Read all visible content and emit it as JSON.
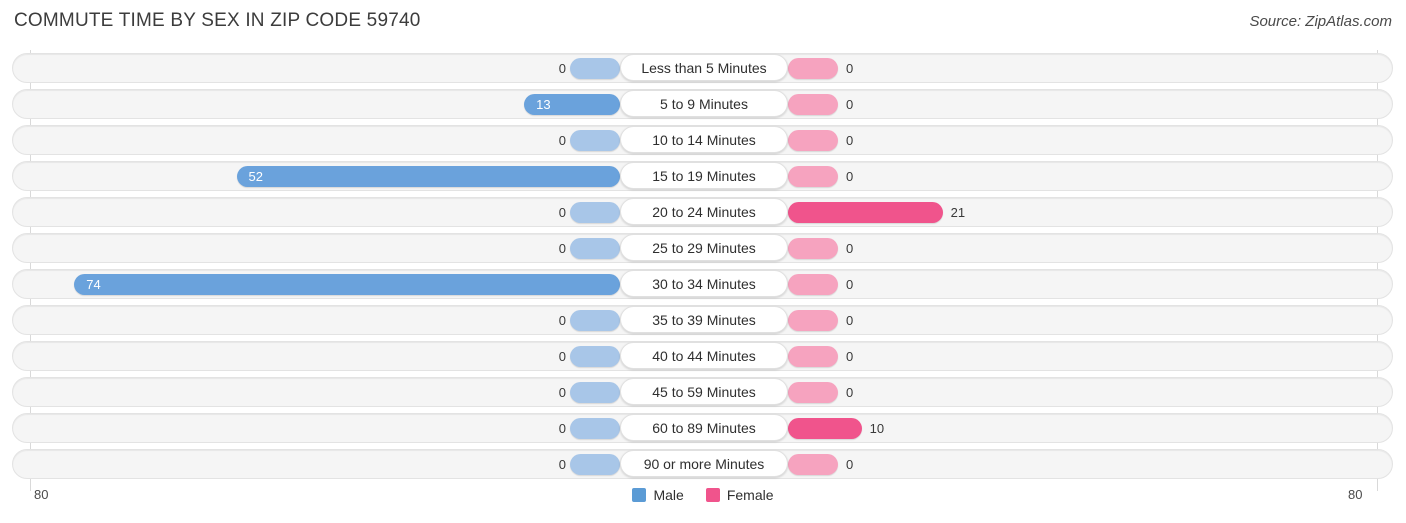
{
  "header": {
    "title": "COMMUTE TIME BY SEX IN ZIP CODE 59740",
    "source": "Source: ZipAtlas.com"
  },
  "axis": {
    "left_label": "80",
    "right_label": "80",
    "max": 80
  },
  "legend": {
    "items": [
      {
        "label": "Male",
        "color": "#5b9bd5",
        "icon": "square-swatch"
      },
      {
        "label": "Female",
        "color": "#f0548c",
        "icon": "square-swatch"
      }
    ]
  },
  "colors": {
    "male_active": "#6aa2dc",
    "male_zero": "#a8c6e8",
    "female_active": "#f0548c",
    "female_zero": "#f6a3bf",
    "track": "#f5f5f5",
    "gridline": "#d9d9d9"
  },
  "chart_data": {
    "type": "bar",
    "title": "COMMUTE TIME BY SEX IN ZIP CODE 59740",
    "subtitle": "Source: ZipAtlas.com",
    "orientation": "horizontal-diverging",
    "xlabel": "",
    "ylabel": "",
    "xlim": [
      80,
      80
    ],
    "grid": true,
    "legend_position": "bottom-center",
    "categories": [
      "Less than 5 Minutes",
      "5 to 9 Minutes",
      "10 to 14 Minutes",
      "15 to 19 Minutes",
      "20 to 24 Minutes",
      "25 to 29 Minutes",
      "30 to 34 Minutes",
      "35 to 39 Minutes",
      "40 to 44 Minutes",
      "45 to 59 Minutes",
      "60 to 89 Minutes",
      "90 or more Minutes"
    ],
    "series": [
      {
        "name": "Male",
        "color": "#5b9bd5",
        "values": [
          0,
          13,
          0,
          52,
          0,
          0,
          74,
          0,
          0,
          0,
          0,
          0
        ]
      },
      {
        "name": "Female",
        "color": "#f0548c",
        "values": [
          0,
          0,
          0,
          0,
          21,
          0,
          0,
          0,
          0,
          0,
          10,
          0
        ]
      }
    ],
    "rows": [
      {
        "category": "Less than 5 Minutes",
        "male": 0,
        "female": 0,
        "male_label": "0",
        "female_label": "0"
      },
      {
        "category": "5 to 9 Minutes",
        "male": 13,
        "female": 0,
        "male_label": "13",
        "female_label": "0"
      },
      {
        "category": "10 to 14 Minutes",
        "male": 0,
        "female": 0,
        "male_label": "0",
        "female_label": "0"
      },
      {
        "category": "15 to 19 Minutes",
        "male": 52,
        "female": 0,
        "male_label": "52",
        "female_label": "0"
      },
      {
        "category": "20 to 24 Minutes",
        "male": 0,
        "female": 21,
        "male_label": "0",
        "female_label": "21"
      },
      {
        "category": "25 to 29 Minutes",
        "male": 0,
        "female": 0,
        "male_label": "0",
        "female_label": "0"
      },
      {
        "category": "30 to 34 Minutes",
        "male": 74,
        "female": 0,
        "male_label": "74",
        "female_label": "0"
      },
      {
        "category": "35 to 39 Minutes",
        "male": 0,
        "female": 0,
        "male_label": "0",
        "female_label": "0"
      },
      {
        "category": "40 to 44 Minutes",
        "male": 0,
        "female": 0,
        "male_label": "0",
        "female_label": "0"
      },
      {
        "category": "45 to 59 Minutes",
        "male": 0,
        "female": 0,
        "male_label": "0",
        "female_label": "0"
      },
      {
        "category": "60 to 89 Minutes",
        "male": 0,
        "female": 10,
        "male_label": "0",
        "female_label": "10"
      },
      {
        "category": "90 or more Minutes",
        "male": 0,
        "female": 0,
        "male_label": "0",
        "female_label": "0"
      }
    ]
  }
}
